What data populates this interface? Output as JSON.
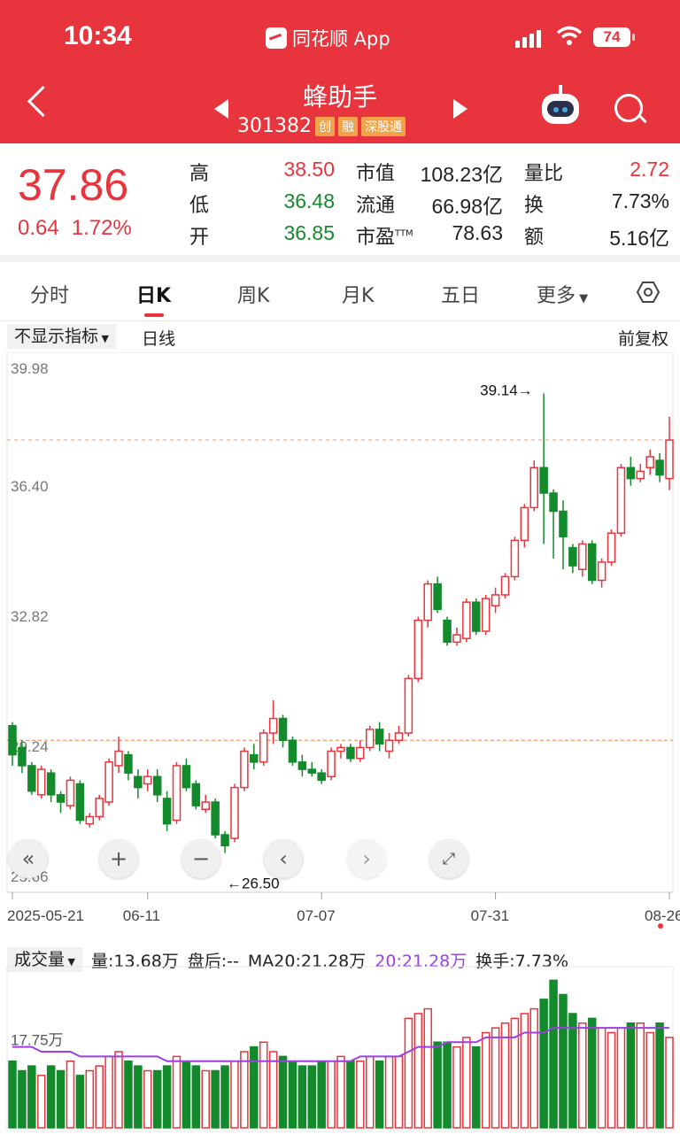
{
  "status_bar": {
    "time": "10:34",
    "app": "同花顺 App",
    "battery": "74"
  },
  "header": {
    "title": "蜂助手",
    "code": "301382",
    "tags": [
      "创",
      "融",
      "深股通"
    ]
  },
  "quote": {
    "price": "37.86",
    "change": "0.64",
    "change_pct": "1.72%",
    "high_label": "高",
    "high": "38.50",
    "low_label": "低",
    "low": "36.48",
    "open_label": "开",
    "open": "36.85",
    "mcap_label": "市值",
    "mcap": "108.23亿",
    "float_label": "流通",
    "float": "66.98亿",
    "pe_label": "市盈",
    "pe_sup": "TTM",
    "pe": "78.63",
    "vr_label": "量比",
    "vr": "2.72",
    "turn_label": "换",
    "turn": "7.73%",
    "amt_label": "额",
    "amt": "5.16亿"
  },
  "tabs": [
    {
      "label": "分时"
    },
    {
      "label": "日K"
    },
    {
      "label": "周K"
    },
    {
      "label": "月K"
    },
    {
      "label": "五日"
    },
    {
      "label": "更多"
    }
  ],
  "controls": {
    "indicator": "不显示指标",
    "line": "日线",
    "adjust": "前复权"
  },
  "colors": {
    "up": "#e8343c",
    "down": "#138a2c",
    "brand": "#e8343c",
    "ma": "#9b3fe0"
  },
  "chart_data": {
    "type": "candlestick",
    "y_ticks": [
      "39.98",
      "36.40",
      "32.82",
      "29.24",
      "25.66"
    ],
    "ylim": [
      25.66,
      39.98
    ],
    "x_ticks": [
      {
        "label": "2025-05-21",
        "i": 0
      },
      {
        "label": "06-11",
        "i": 14
      },
      {
        "label": "07-07",
        "i": 32
      },
      {
        "label": "07-31",
        "i": 50
      },
      {
        "label": "08-26",
        "i": 68
      }
    ],
    "high_marker": "39.14→",
    "low_marker": "←26.50",
    "ohlc": [
      [
        30.0,
        29.2,
        30.1,
        28.9
      ],
      [
        29.4,
        28.9,
        29.6,
        28.7
      ],
      [
        28.9,
        28.2,
        29.0,
        28.1
      ],
      [
        28.1,
        28.8,
        28.9,
        28.0
      ],
      [
        28.7,
        28.1,
        28.8,
        27.9
      ],
      [
        28.1,
        27.9,
        28.2,
        27.6
      ],
      [
        27.8,
        28.5,
        28.6,
        27.7
      ],
      [
        28.4,
        27.4,
        28.5,
        27.3
      ],
      [
        27.3,
        27.5,
        27.6,
        27.2
      ],
      [
        27.5,
        28.0,
        28.1,
        27.4
      ],
      [
        27.9,
        29.0,
        29.1,
        27.8
      ],
      [
        28.9,
        29.3,
        29.7,
        28.7
      ],
      [
        29.2,
        28.7,
        29.3,
        28.5
      ],
      [
        28.6,
        28.3,
        28.8,
        28.0
      ],
      [
        28.4,
        28.6,
        28.8,
        28.2
      ],
      [
        28.6,
        28.1,
        28.8,
        27.9
      ],
      [
        28.0,
        27.3,
        28.2,
        27.1
      ],
      [
        27.4,
        28.9,
        29.0,
        27.3
      ],
      [
        28.9,
        28.3,
        29.1,
        28.2
      ],
      [
        28.4,
        27.8,
        28.5,
        27.7
      ],
      [
        27.7,
        27.9,
        28.1,
        27.6
      ],
      [
        27.9,
        27.0,
        28.0,
        26.9
      ],
      [
        27.0,
        26.7,
        27.1,
        26.5
      ],
      [
        26.9,
        28.3,
        28.4,
        26.8
      ],
      [
        28.3,
        29.3,
        29.4,
        28.2
      ],
      [
        29.2,
        29.0,
        29.5,
        28.8
      ],
      [
        29.0,
        29.8,
        29.9,
        28.9
      ],
      [
        29.8,
        30.2,
        30.7,
        29.5
      ],
      [
        30.2,
        29.6,
        30.3,
        29.4
      ],
      [
        29.6,
        29.0,
        29.7,
        28.9
      ],
      [
        29.0,
        28.8,
        29.2,
        28.6
      ],
      [
        28.8,
        28.7,
        29.0,
        28.6
      ],
      [
        28.7,
        28.5,
        28.8,
        28.4
      ],
      [
        28.6,
        29.3,
        29.4,
        28.5
      ],
      [
        29.3,
        29.4,
        29.5,
        29.1
      ],
      [
        29.4,
        29.1,
        29.5,
        29.0
      ],
      [
        29.1,
        29.4,
        29.6,
        29.0
      ],
      [
        29.4,
        29.9,
        30.0,
        29.3
      ],
      [
        29.9,
        29.5,
        30.1,
        29.3
      ],
      [
        29.3,
        29.6,
        29.8,
        29.1
      ],
      [
        29.6,
        29.8,
        30.0,
        29.5
      ],
      [
        29.8,
        31.3,
        31.4,
        29.7
      ],
      [
        31.3,
        32.9,
        33.0,
        31.2
      ],
      [
        32.9,
        33.9,
        34.0,
        32.7
      ],
      [
        33.9,
        33.2,
        34.1,
        33.1
      ],
      [
        32.9,
        32.3,
        33.0,
        32.2
      ],
      [
        32.3,
        32.5,
        32.7,
        32.2
      ],
      [
        32.4,
        33.4,
        33.5,
        32.3
      ],
      [
        33.4,
        32.6,
        33.5,
        32.5
      ],
      [
        32.6,
        33.5,
        33.6,
        32.5
      ],
      [
        33.3,
        33.6,
        33.8,
        33.1
      ],
      [
        33.6,
        34.1,
        34.2,
        33.5
      ],
      [
        34.1,
        35.1,
        35.2,
        34.0
      ],
      [
        35.1,
        36.0,
        36.1,
        34.9
      ],
      [
        36.0,
        37.1,
        37.3,
        35.9
      ],
      [
        37.1,
        36.4,
        39.14,
        35.0
      ],
      [
        36.4,
        35.9,
        36.5,
        34.6
      ],
      [
        35.9,
        35.2,
        36.2,
        34.3
      ],
      [
        34.9,
        34.4,
        35.0,
        34.2
      ],
      [
        34.3,
        35.0,
        35.1,
        34.1
      ],
      [
        35.0,
        34.0,
        35.1,
        33.9
      ],
      [
        34.0,
        34.5,
        34.6,
        33.8
      ],
      [
        34.5,
        35.3,
        35.4,
        34.4
      ],
      [
        35.3,
        37.1,
        37.2,
        35.2
      ],
      [
        37.1,
        36.8,
        37.4,
        36.6
      ],
      [
        36.8,
        37.0,
        37.2,
        36.7
      ],
      [
        37.1,
        37.4,
        37.6,
        36.9
      ],
      [
        37.3,
        36.9,
        37.5,
        36.7
      ],
      [
        36.8,
        37.86,
        38.5,
        36.48
      ]
    ],
    "volume_label": "成交量",
    "volume_info": [
      "量:13.68万",
      "盘后:--",
      "MA20:21.28万"
    ],
    "volume_ma": "20:21.28万",
    "volume_turn": "换手:7.73%",
    "volume_tick": "17.75万",
    "volume": [
      14,
      12,
      13,
      11,
      13,
      12,
      14,
      11,
      12,
      13,
      15,
      16,
      14,
      13,
      12,
      12,
      13,
      15,
      14,
      13,
      12,
      12,
      13,
      14,
      16,
      17,
      18,
      16,
      15,
      14,
      13,
      13,
      14,
      14,
      15,
      14,
      14,
      15,
      14,
      15,
      15,
      23,
      24,
      25,
      18,
      18,
      17,
      19,
      17,
      20,
      21,
      22,
      23,
      24,
      25,
      27,
      31,
      28,
      24,
      22,
      23,
      21,
      20,
      21,
      22,
      22,
      20,
      22,
      19
    ],
    "volume_ma_line": [
      17,
      17,
      17,
      16,
      16,
      16,
      16,
      15,
      15,
      15,
      15,
      15,
      15,
      15,
      15,
      15,
      14,
      14,
      14,
      14,
      14,
      14,
      14,
      14,
      14,
      14,
      14,
      14,
      14,
      14,
      14,
      14,
      14,
      14,
      14,
      14,
      15,
      15,
      15,
      15,
      15,
      16,
      17,
      17,
      17,
      18,
      18,
      18,
      18,
      19,
      19,
      19,
      19,
      20,
      20,
      20,
      21,
      21,
      21,
      21,
      21,
      21,
      21,
      21,
      21,
      21,
      21,
      21,
      21
    ]
  }
}
